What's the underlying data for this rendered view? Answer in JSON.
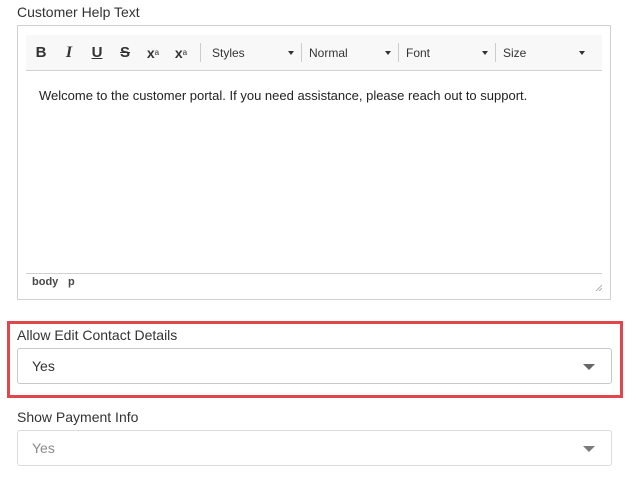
{
  "customer_help_text": {
    "label": "Customer Help Text",
    "toolbar": {
      "bold": "B",
      "italic": "I",
      "underline": "U",
      "strike": "S",
      "subscript_base": "x",
      "subscript_mark": "a",
      "superscript_base": "x",
      "superscript_mark": "a",
      "styles": "Styles",
      "format": "Normal",
      "font": "Font",
      "size": "Size"
    },
    "content": "Welcome to the customer portal. If you need assistance, please reach out to support.",
    "path": [
      "body",
      "p"
    ]
  },
  "allow_edit_contact_details": {
    "label": "Allow Edit Contact Details",
    "value": "Yes",
    "highlight_color": "#e0474c"
  },
  "show_payment_info": {
    "label": "Show Payment Info",
    "value": "Yes"
  }
}
